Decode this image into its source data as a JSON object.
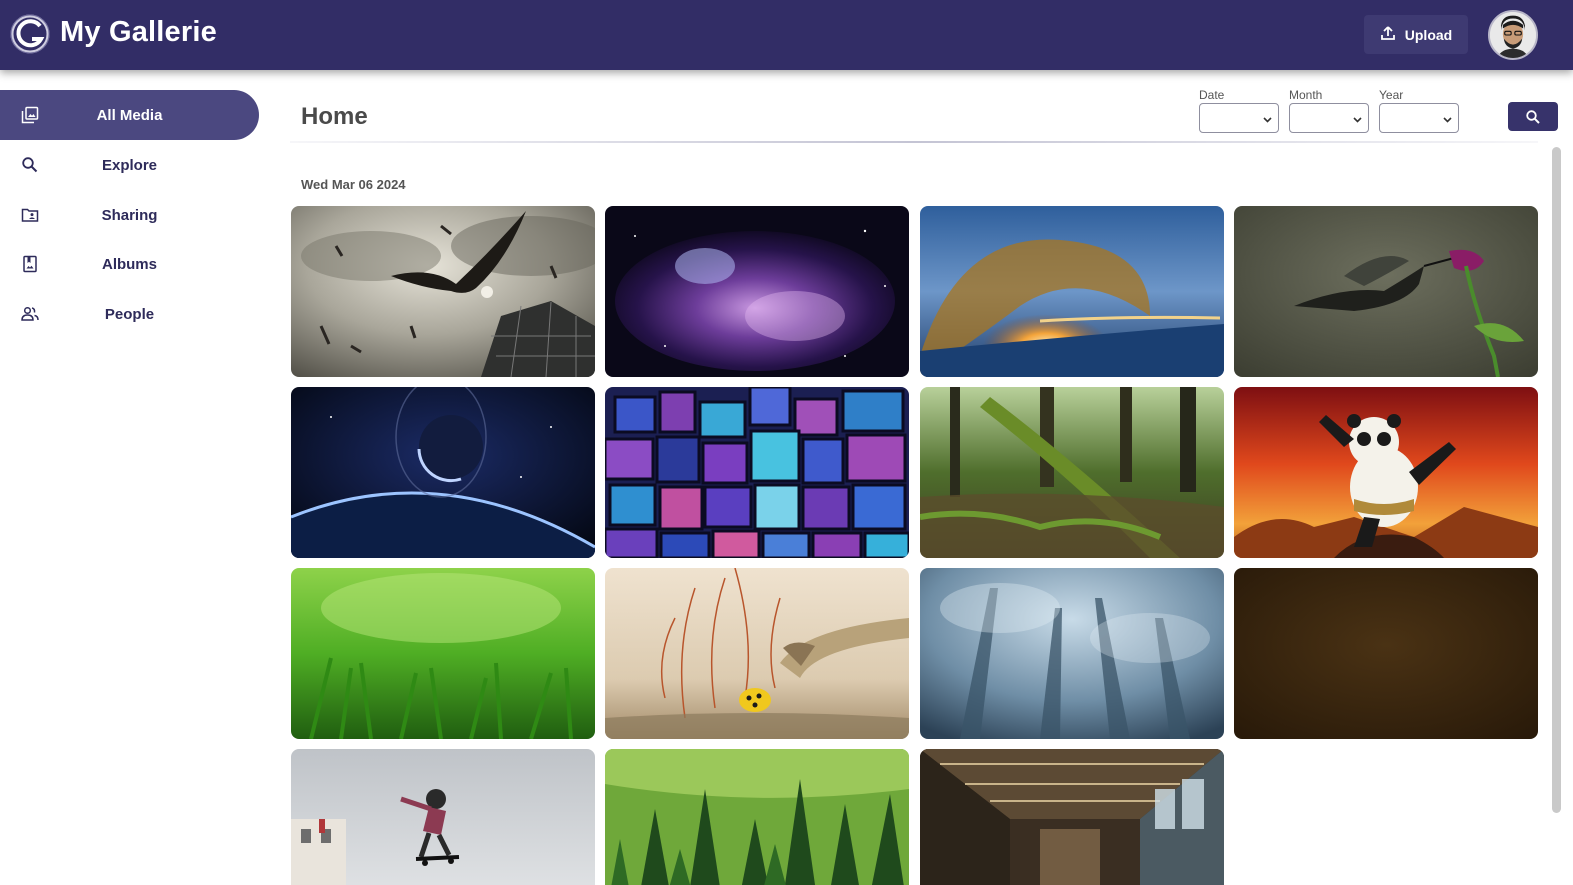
{
  "header": {
    "logo_icon": "gallery-g-logo-icon",
    "title": "My Gallerie",
    "upload_label": "Upload",
    "upload_icon": "upload-icon",
    "avatar_icon": "user-avatar"
  },
  "sidebar": {
    "items": [
      {
        "label": "All Media",
        "icon": "photo-library-icon",
        "active": true
      },
      {
        "label": "Explore",
        "icon": "search-icon",
        "active": false
      },
      {
        "label": "Sharing",
        "icon": "shared-folder-icon",
        "active": false
      },
      {
        "label": "Albums",
        "icon": "album-icon",
        "active": false
      },
      {
        "label": "People",
        "icon": "people-icon",
        "active": false
      }
    ]
  },
  "main": {
    "title": "Home",
    "filters": [
      {
        "label": "Date",
        "value": ""
      },
      {
        "label": "Month",
        "value": ""
      },
      {
        "label": "Year",
        "value": ""
      }
    ],
    "search_icon": "search-icon",
    "date_group": "Wed Mar 06 2024"
  },
  "colors": {
    "header_bg": "#322d66",
    "active_nav": "#4b4880",
    "button_bg": "#37336b"
  },
  "photos": [
    {
      "subject": "eagle-over-glass-dome"
    },
    {
      "subject": "purple-nebula"
    },
    {
      "subject": "ocean-wave-sunset"
    },
    {
      "subject": "hummingbird-flower"
    },
    {
      "subject": "planet-from-space"
    },
    {
      "subject": "colorful-cubes"
    },
    {
      "subject": "mossy-forest-log"
    },
    {
      "subject": "kung-fu-panda"
    },
    {
      "subject": "green-grass"
    },
    {
      "subject": "snake-and-ladybug"
    },
    {
      "subject": "misty-forest"
    },
    {
      "subject": "brown-texture"
    },
    {
      "subject": "skateboarder-jump"
    },
    {
      "subject": "pine-forest"
    },
    {
      "subject": "industrial-hall"
    }
  ]
}
